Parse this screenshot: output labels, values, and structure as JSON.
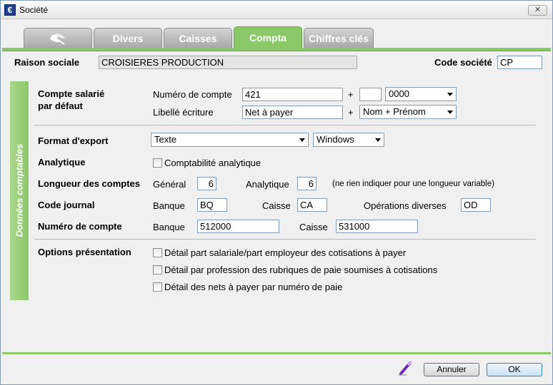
{
  "window": {
    "title": "Société",
    "app_icon_glyph": "€",
    "close_glyph": "✕"
  },
  "tabs": [
    {
      "label": "",
      "icon": "dragonfly-logo-icon"
    },
    {
      "label": "Divers"
    },
    {
      "label": "Caisses"
    },
    {
      "label": "Compta",
      "active": true
    },
    {
      "label": "Chiffres clés"
    }
  ],
  "header": {
    "raison_label": "Raison sociale",
    "raison_value": "CROISIERES PRODUCTION",
    "code_label": "Code société",
    "code_value": "CP"
  },
  "group": {
    "label": "Données comptables"
  },
  "compte_salarie": {
    "label_line1": "Compte salarié",
    "label_line2": "par défaut",
    "numero_label": "Numéro de compte",
    "numero_value": "421",
    "plus1": "+",
    "extra_value": "",
    "suffix_select": "0000",
    "libelle_label": "Libellé écriture",
    "libelle_value": "Net à payer",
    "plus2": "+",
    "libelle_select": "Nom + Prénom"
  },
  "export": {
    "label": "Format d'export",
    "format": "Texte",
    "platform": "Windows"
  },
  "analytique": {
    "label": "Analytique",
    "checkbox_label": "Comptabilité analytique"
  },
  "longueur": {
    "label": "Longueur des comptes",
    "general_label": "Général",
    "general_value": "6",
    "analytique_label": "Analytique",
    "analytique_value": "6",
    "hint": "(ne rien indiquer pour une longueur variable)"
  },
  "journal": {
    "label": "Code journal",
    "banque_label": "Banque",
    "banque_value": "BQ",
    "caisse_label": "Caisse",
    "caisse_value": "CA",
    "od_label": "Opérations diverses",
    "od_value": "OD"
  },
  "numero_compte": {
    "label": "Numéro de compte",
    "banque_label": "Banque",
    "banque_value": "512000",
    "caisse_label": "Caisse",
    "caisse_value": "531000"
  },
  "options": {
    "label": "Options présentation",
    "items": [
      "Détail part salariale/part employeur des cotisations à payer",
      "Détail par profession des rubriques de paie soumises à cotisations",
      "Détail des nets à payer par numéro de paie"
    ]
  },
  "footer": {
    "cancel_label": "Annuler",
    "ok_label": "OK",
    "edit_icon": "pen-icon"
  },
  "colors": {
    "accent_green": "#8bc867",
    "tab_gray": "#a9a9a9",
    "field_border": "#7f9db9"
  }
}
